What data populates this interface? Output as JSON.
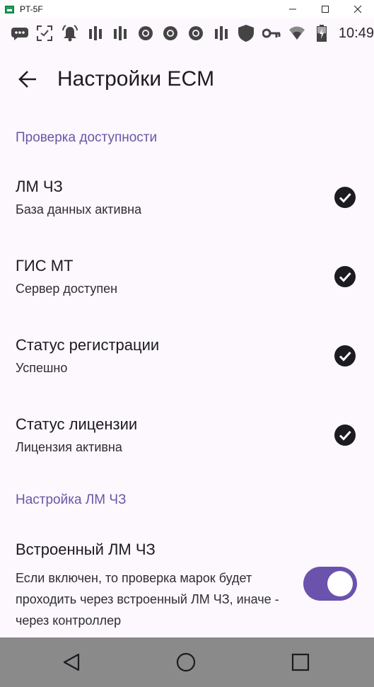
{
  "window": {
    "title": "PT-5F",
    "controls": [
      "minimize-icon",
      "maximize-icon",
      "close-icon"
    ]
  },
  "status_bar": {
    "icons": [
      "chat-bubble-icon",
      "scan-icon",
      "alarm-bell-icon",
      "signal-bars-icon",
      "signal-bars-icon",
      "chrome-icon",
      "chrome-icon",
      "chrome-icon",
      "signal-bars-icon",
      "shield-icon",
      "key-icon",
      "wifi-icon",
      "battery-icon"
    ],
    "time": "10:49"
  },
  "app_bar": {
    "title": "Настройки ECM"
  },
  "sections": {
    "availability": {
      "header": "Проверка доступности",
      "items": [
        {
          "title": "ЛМ ЧЗ",
          "summary": "База данных активна",
          "status_icon": "check-circle-icon"
        },
        {
          "title": "ГИС МТ",
          "summary": "Сервер доступен",
          "status_icon": "check-circle-icon"
        },
        {
          "title": "Статус регистрации",
          "summary": "Успешно",
          "status_icon": "check-circle-icon"
        },
        {
          "title": "Статус лицензии",
          "summary": "Лицензия активна",
          "status_icon": "check-circle-icon"
        }
      ]
    },
    "lm_settings": {
      "header": "Настройка ЛМ ЧЗ",
      "embedded_lm": {
        "title": "Встроенный ЛМ ЧЗ",
        "summary": "Если включен, то проверка марок будет проходить через встроенный ЛМ ЧЗ, иначе - через контроллер",
        "enabled": true
      }
    }
  },
  "nav_bar": {
    "buttons": [
      "back-triangle-icon",
      "home-circle-icon",
      "recents-square-icon"
    ]
  },
  "colors": {
    "accent": "#6a56a6",
    "switch_track": "#6a52ad",
    "screen_background": "#fdf7fe",
    "nav_bar": "#8a8a8a"
  }
}
